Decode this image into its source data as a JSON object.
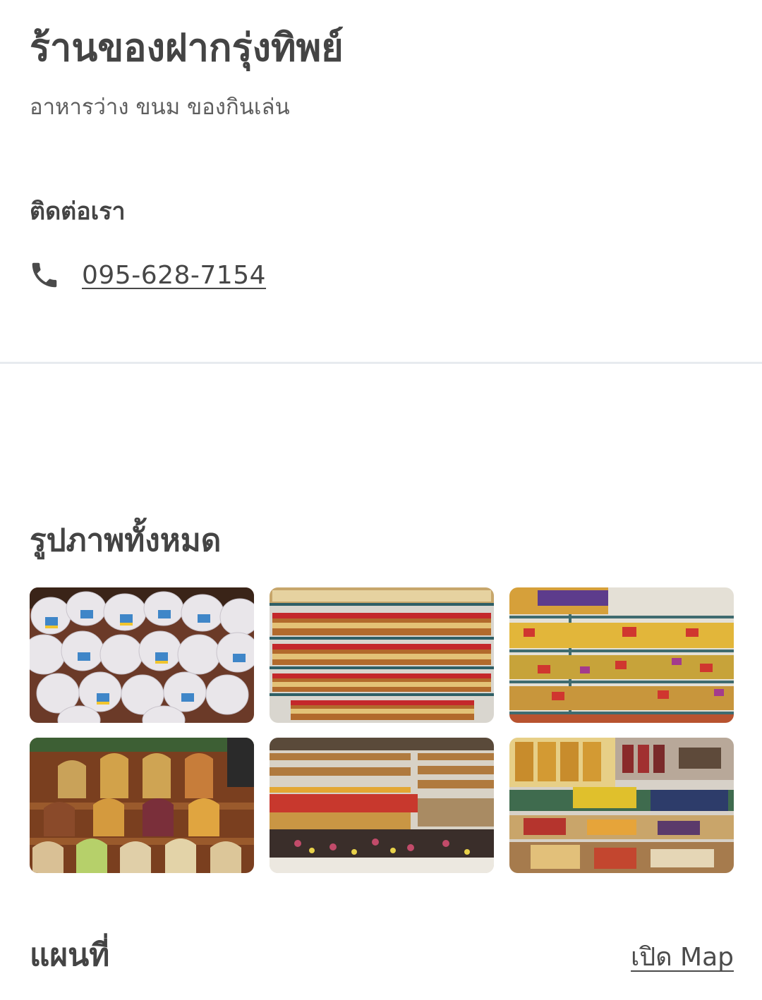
{
  "shop": {
    "title": "ร้านของฝากรุ่งทิพย์",
    "category": "อาหารว่าง ขนม ของกินเล่น"
  },
  "contact": {
    "heading": "ติดต่อเรา",
    "phone_icon": "phone-icon",
    "phone": "095-628-7154"
  },
  "photos": {
    "heading": "รูปภาพทั้งหมด",
    "items": [
      {
        "name": "photo-snack-bags-white"
      },
      {
        "name": "photo-shelves-jars-red"
      },
      {
        "name": "photo-shelves-colorful-packs"
      },
      {
        "name": "photo-clear-bags-nuts"
      },
      {
        "name": "photo-store-display-counter"
      },
      {
        "name": "photo-packaged-snacks-rows"
      }
    ]
  },
  "map": {
    "heading": "แผนที่",
    "open_label": "เปิด Map"
  },
  "colors": {
    "text_primary": "#444444",
    "text_secondary": "#5e5e5e",
    "divider": "#e7ebef",
    "background": "#ffffff"
  }
}
